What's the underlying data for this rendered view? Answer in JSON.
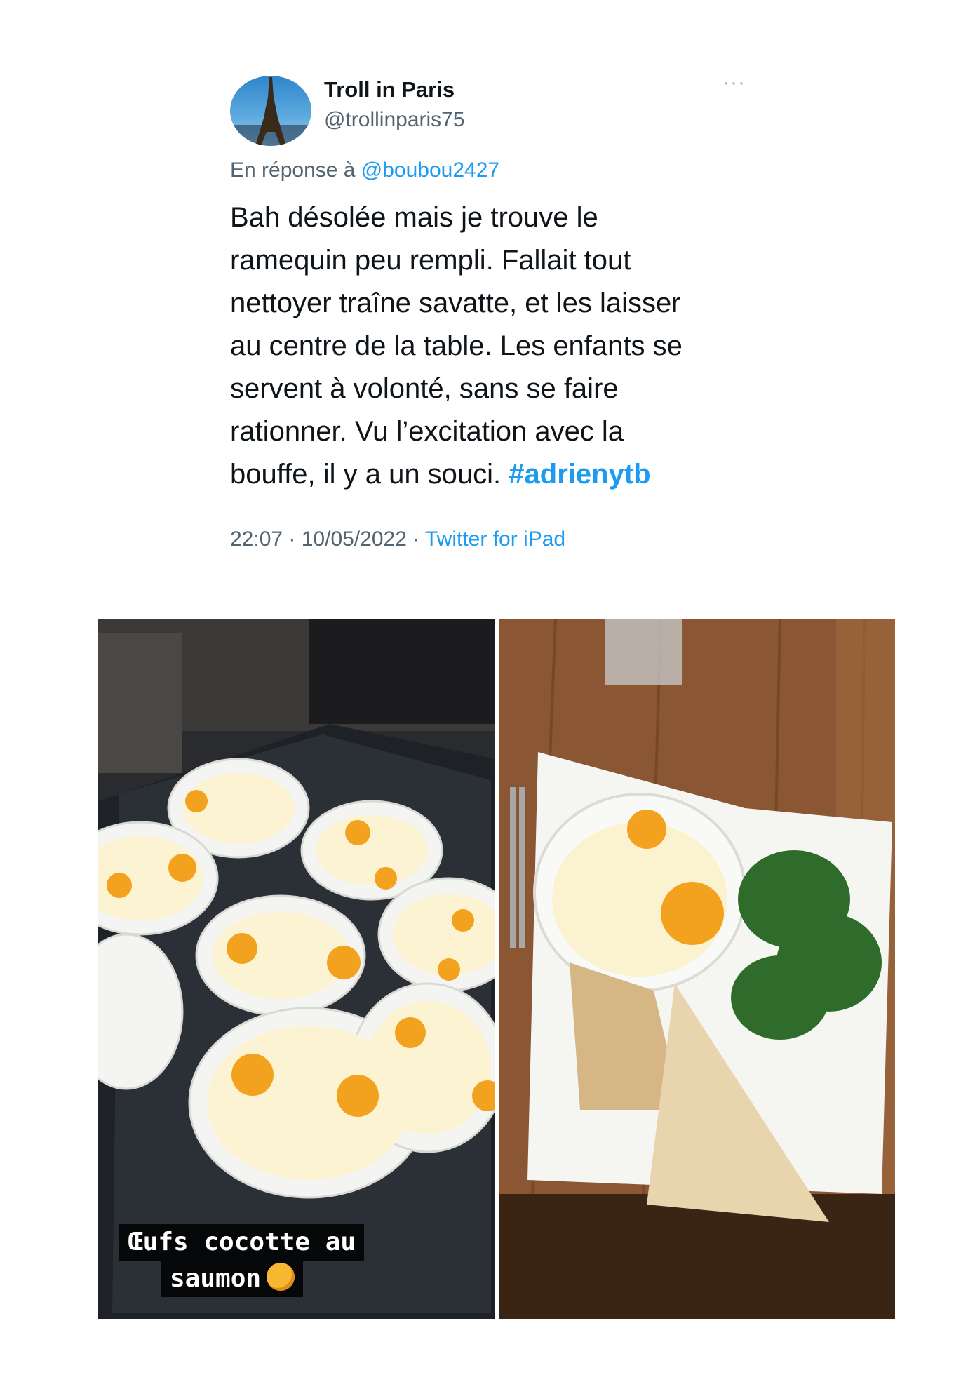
{
  "tweet": {
    "display_name": "Troll in Paris",
    "handle": "@trollinparis75",
    "more_glyph": "···",
    "reply_prefix": "En réponse à ",
    "reply_mention": "@boubou2427",
    "text_lines": [
      "Bah désolée mais je trouve le",
      "ramequin peu rempli. Fallait tout",
      "nettoyer traîne savatte, et les laisser",
      "au centre de la table. Les enfants se",
      "servent à volonté, sans se faire",
      "rationner. Vu l’excitation avec la",
      "bouffe, il y a un souci. "
    ],
    "hashtag": "#adrienytb",
    "timestamp": "22:07 · 10/05/2022 · ",
    "source": "Twitter for iPad"
  },
  "media": {
    "caption_line1": "Œufs cocotte au",
    "caption_line2": "saumon",
    "emoji_name": "smiling-face-with-hearts-icon"
  },
  "colors": {
    "link": "#1d9bf0",
    "text": "#0f1419",
    "secondary": "#536471"
  }
}
